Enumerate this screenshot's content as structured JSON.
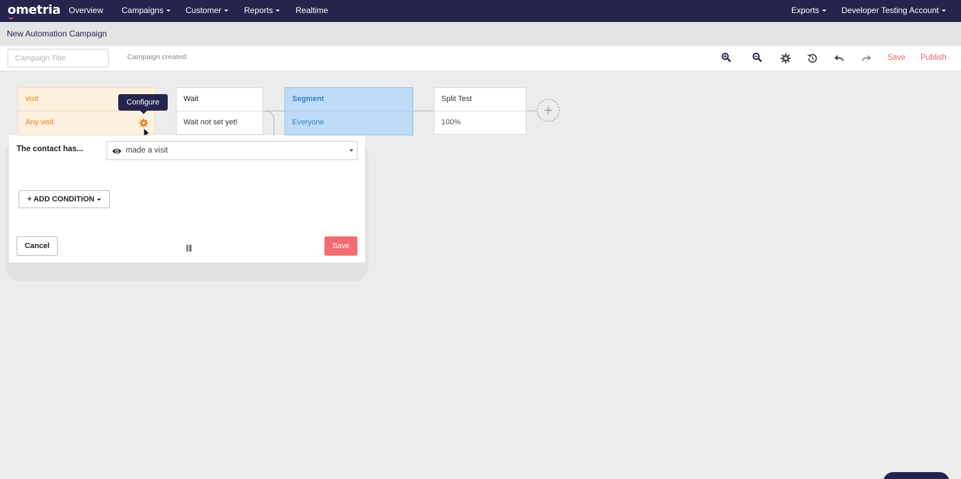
{
  "nav": {
    "logo": "ometria",
    "items": [
      {
        "label": "Overview",
        "dropdown": false
      },
      {
        "label": "Campaigns",
        "dropdown": true
      },
      {
        "label": "Customer",
        "dropdown": true
      },
      {
        "label": "Reports",
        "dropdown": true
      },
      {
        "label": "Realtime",
        "dropdown": false
      }
    ],
    "right": [
      {
        "label": "Exports",
        "dropdown": true
      },
      {
        "label": "Developer Testing Account",
        "dropdown": true
      }
    ]
  },
  "page": {
    "title": "New Automation Campaign"
  },
  "toolbar": {
    "title_placeholder": "Campaign Title",
    "title_value": "",
    "created_label": "Campaign created:",
    "icons": [
      "zoom-in-icon",
      "zoom-out-icon",
      "settings-icon",
      "history-icon",
      "undo-icon",
      "redo-icon"
    ],
    "save_label": "Save",
    "publish_label": "Publish",
    "accent_color": "#e8636b"
  },
  "nodes": {
    "trigger": {
      "title": "visit",
      "subtitle": "Any visit",
      "color": "#e9831b",
      "bg": "#fdf0de"
    },
    "wait": {
      "title": "Wait",
      "subtitle": "Wait not set yet!"
    },
    "segment": {
      "title": "Segment",
      "subtitle": "Everyone",
      "color": "#3b7fc4",
      "bg": "#bddcf7"
    },
    "split": {
      "title": "Split Test",
      "subtitle": "100%"
    }
  },
  "tooltip": {
    "text": "Configure"
  },
  "panel": {
    "label": "The contact has...",
    "select_value": "made a visit",
    "add_condition_label": "+ ADD CONDITION",
    "cancel_label": "Cancel",
    "save_label": "Save"
  },
  "colors": {
    "nav_bg": "#25244d",
    "save_btn": "#f36d72"
  }
}
